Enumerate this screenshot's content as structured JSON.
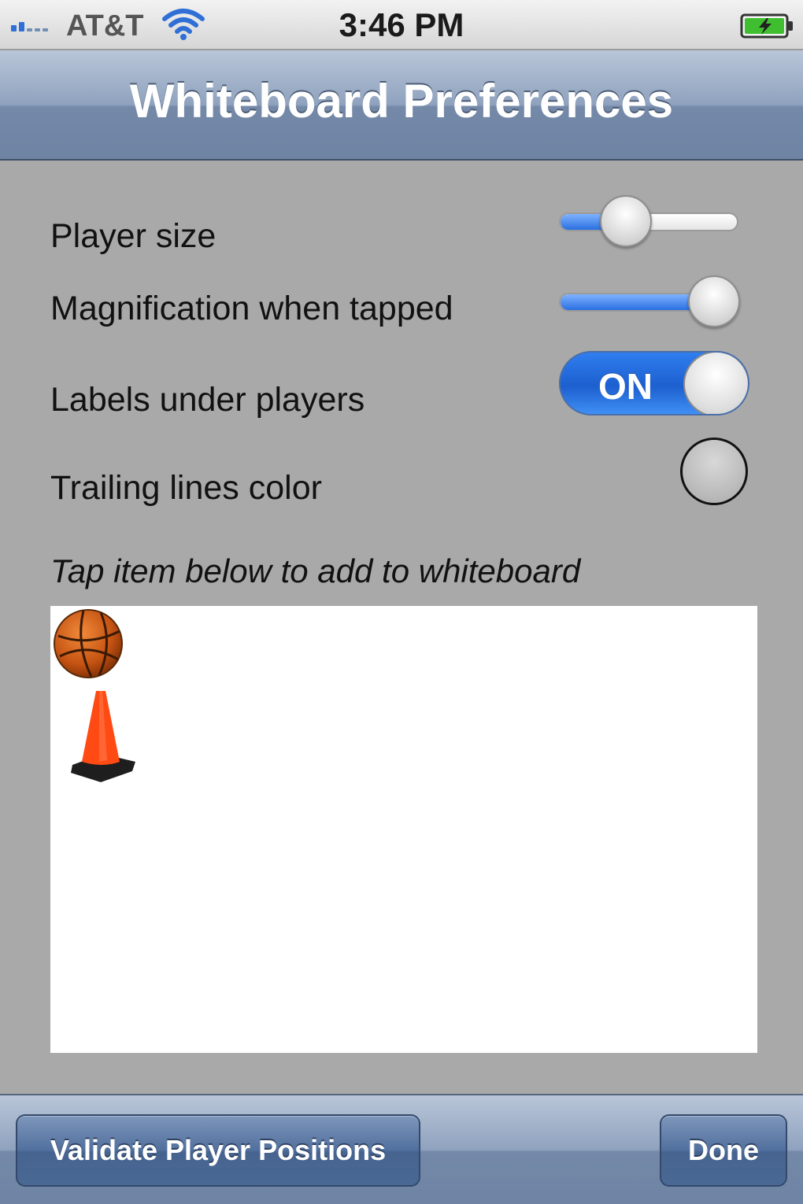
{
  "status_bar": {
    "carrier": "AT&T",
    "time": "3:46 PM",
    "signal_icon": "signal-bars-icon",
    "wifi_icon": "wifi-icon",
    "battery_icon": "battery-charging-icon"
  },
  "nav": {
    "title": "Whiteboard Preferences"
  },
  "preferences": {
    "player_size": {
      "label": "Player size",
      "value_fraction": 0.37
    },
    "magnification": {
      "label": "Magnification when tapped",
      "value_fraction": 0.87
    },
    "labels_under_players": {
      "label": "Labels under players",
      "state": "ON"
    },
    "trailing_lines_color": {
      "label": "Trailing lines color",
      "color": "#aaaaaa"
    }
  },
  "palette": {
    "hint": "Tap item below to add to whiteboard",
    "items": [
      {
        "name": "basketball-icon"
      },
      {
        "name": "traffic-cone-icon"
      }
    ]
  },
  "toolbar": {
    "validate_label": "Validate Player Positions",
    "done_label": "Done"
  },
  "colors": {
    "accent_blue": "#2a6fe0",
    "nav_bar": "#8fa2be",
    "background": "#a9a9a9"
  }
}
